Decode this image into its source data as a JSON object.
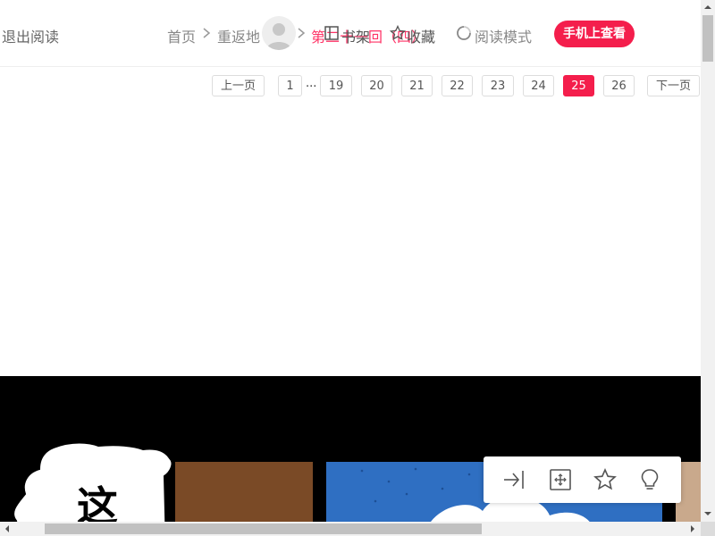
{
  "header": {
    "exit_label": "退出阅读",
    "breadcrumb": [
      "首页",
      "重返地",
      "第二十一回（四）"
    ],
    "shelf_label": "书架",
    "favorite_label": "收藏",
    "read_mode_label": "阅读模式",
    "mobile_button": "手机上查看"
  },
  "pager": {
    "prev": "上一页",
    "next": "下一页",
    "ellipsis": "...",
    "pages": [
      "1",
      "19",
      "20",
      "21",
      "22",
      "23",
      "24",
      "25",
      "26"
    ],
    "current": "25"
  },
  "comic": {
    "bubble_text": "这"
  },
  "toolbar": {
    "icons": [
      "collapse-right-icon",
      "fit-screen-icon",
      "star-icon",
      "lightbulb-icon"
    ]
  },
  "colors": {
    "accent": "#f41e4c",
    "breadcrumb_active": "#f36"
  }
}
